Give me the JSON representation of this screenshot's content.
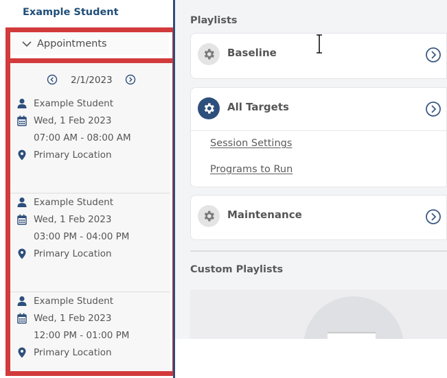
{
  "student": {
    "name": "Example Student"
  },
  "appointments": {
    "section_label": "Appointments",
    "nav": {
      "date": "2/1/2023",
      "prev_icon": "chevron-left-circle-icon",
      "next_icon": "chevron-right-circle-icon"
    },
    "items": [
      {
        "student": "Example Student",
        "date": "Wed, 1 Feb 2023",
        "time": "07:00 AM - 08:00 AM",
        "location": "Primary Location"
      },
      {
        "student": "Example Student",
        "date": "Wed, 1 Feb 2023",
        "time": "03:00 PM - 04:00 PM",
        "location": "Primary Location"
      },
      {
        "student": "Example Student",
        "date": "Wed, 1 Feb 2023",
        "time": "12:00 PM - 01:00 PM",
        "location": "Primary Location"
      }
    ]
  },
  "playlists": {
    "section_label": "Playlists",
    "items": [
      {
        "name": "Baseline",
        "icon": "gear-icon",
        "icon_style": "grey"
      },
      {
        "name": "All Targets",
        "icon": "gear-icon",
        "icon_style": "navy",
        "links": [
          "Session Settings",
          "Programs to Run"
        ]
      },
      {
        "name": "Maintenance",
        "icon": "gear-icon",
        "icon_style": "grey"
      }
    ]
  },
  "custom_playlists": {
    "section_label": "Custom Playlists"
  },
  "colors": {
    "accent_navy": "#2d4f7c",
    "header_text": "#1f4e79",
    "highlight_red": "#d23a3c",
    "pane_bg": "#f3f4f6"
  }
}
